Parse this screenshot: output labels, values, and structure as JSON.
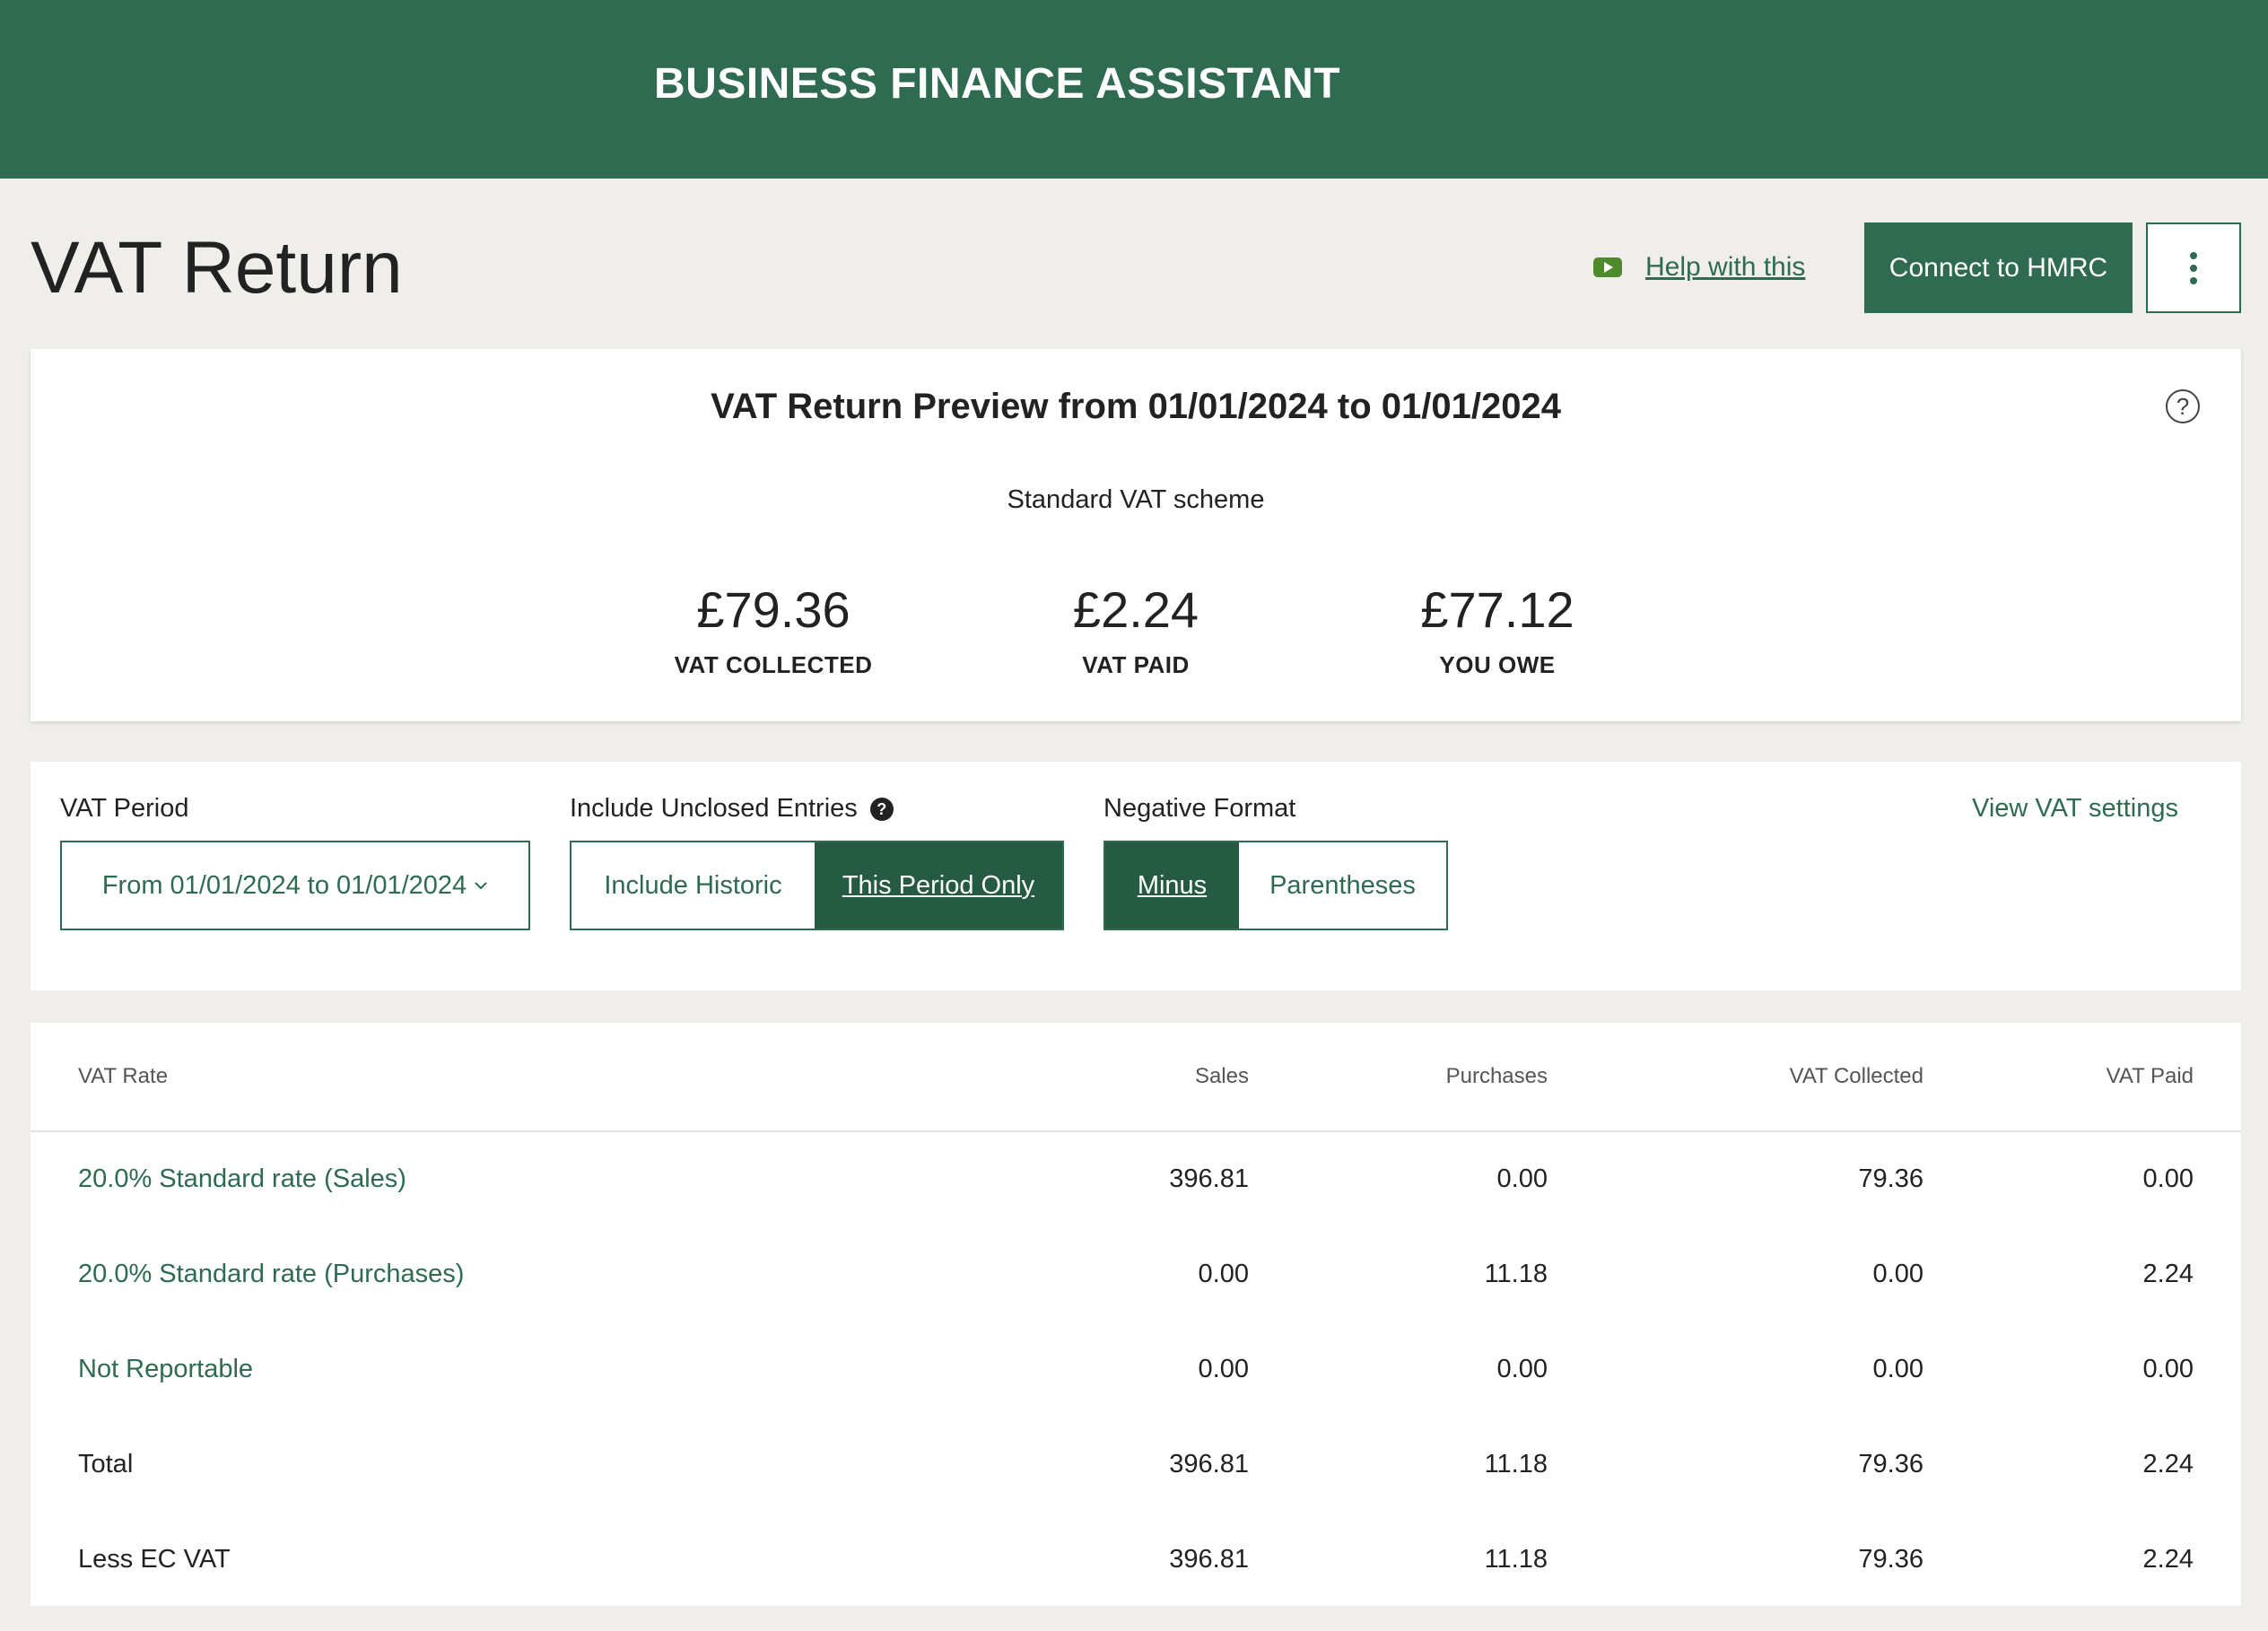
{
  "header": {
    "brand": "BUSINESS FINANCE ASSISTANT"
  },
  "page": {
    "title": "VAT Return",
    "help_label": "Help with this",
    "connect_label": "Connect to HMRC"
  },
  "summary": {
    "title": "VAT Return Preview from 01/01/2024 to 01/01/2024",
    "scheme": "Standard VAT scheme",
    "help_icon": "?",
    "stats": [
      {
        "amount": "£79.36",
        "label": "VAT COLLECTED"
      },
      {
        "amount": "£2.24",
        "label": "VAT PAID"
      },
      {
        "amount": "£77.12",
        "label": "YOU OWE"
      }
    ]
  },
  "filters": {
    "vat_period_label": "VAT Period",
    "vat_period_value": "From 01/01/2024 to 01/01/2024",
    "unclosed_label": "Include Unclosed Entries",
    "unclosed_options": [
      "Include Historic",
      "This Period Only"
    ],
    "unclosed_selected": "This Period Only",
    "negative_label": "Negative Format",
    "negative_options": [
      "Minus",
      "Parentheses"
    ],
    "negative_selected": "Minus",
    "view_settings": "View VAT settings"
  },
  "table": {
    "headers": [
      "VAT Rate",
      "Sales",
      "Purchases",
      "VAT Collected",
      "VAT Paid"
    ],
    "rows": [
      {
        "rate": "20.0% Standard rate (Sales)",
        "sales": "396.81",
        "purchases": "0.00",
        "collected": "79.36",
        "paid": "0.00",
        "link": true
      },
      {
        "rate": "20.0% Standard rate (Purchases)",
        "sales": "0.00",
        "purchases": "11.18",
        "collected": "0.00",
        "paid": "2.24",
        "link": true
      },
      {
        "rate": "Not Reportable",
        "sales": "0.00",
        "purchases": "0.00",
        "collected": "0.00",
        "paid": "0.00",
        "link": true
      },
      {
        "rate": "Total",
        "sales": "396.81",
        "purchases": "11.18",
        "collected": "79.36",
        "paid": "2.24",
        "link": false
      },
      {
        "rate": "Less EC VAT",
        "sales": "396.81",
        "purchases": "11.18",
        "collected": "79.36",
        "paid": "2.24",
        "link": false
      }
    ]
  },
  "colors": {
    "brand": "#2e6b51",
    "active": "#255a43",
    "background": "#efeeea",
    "video_icon": "#4f8a2c"
  },
  "icons": [
    "video-play-icon",
    "more-vertical-icon",
    "help-circle-icon",
    "info-icon",
    "chevron-down-icon"
  ]
}
